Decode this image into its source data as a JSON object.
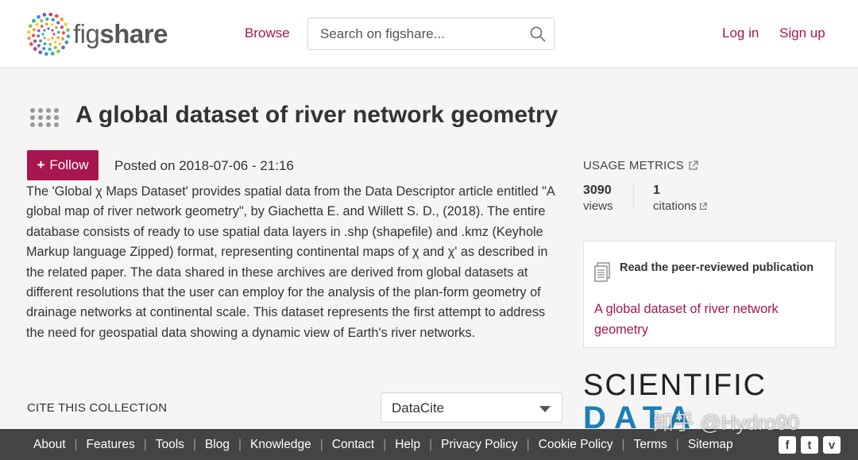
{
  "header": {
    "logo_text_fig": "fig",
    "logo_text_share": "share",
    "browse_label": "Browse",
    "search_placeholder": "Search on figshare...",
    "login_label": "Log in",
    "signup_label": "Sign up"
  },
  "item": {
    "title": "A global dataset of river network geometry",
    "follow_label": "Follow",
    "posted": "Posted on 2018-07-06 - 21:16",
    "description": "The 'Global χ Maps Dataset' provides spatial data from the Data Descriptor article entitled \"A global map of river network geometry\", by Giachetta E. and Willett S. D., (2018). The entire database consists of ready to use spatial data layers in .shp (shapefile) and .kmz (Keyhole Markup language Zipped) format, representing continental maps of χ and χ' as described in the related paper. The data shared in these archives are derived from global datasets at different resolutions that the user can employ for the analysis of the plan-form geometry of drainage networks at continental scale. This dataset represents the first attempt to address the need for geospatial data showing a dynamic view of Earth's river networks."
  },
  "cite": {
    "label": "CITE THIS COLLECTION",
    "selected": "DataCite"
  },
  "metrics": {
    "label": "USAGE METRICS",
    "views_count": "3090",
    "views_label": "views",
    "citations_count": "1",
    "citations_label": "citations"
  },
  "publication": {
    "heading": "Read the peer-reviewed publication",
    "link": "A global dataset of river network geometry"
  },
  "journal": {
    "line1": "SCIENTIFIC",
    "line2": "DATA"
  },
  "footer": {
    "links": [
      "About",
      "Features",
      "Tools",
      "Blog",
      "Knowledge",
      "Contact",
      "Help",
      "Privacy Policy",
      "Cookie Policy",
      "Terms",
      "Sitemap"
    ],
    "social": [
      "f",
      "t",
      "v"
    ]
  },
  "watermark": "知乎 @Hydro90",
  "colors": {
    "accent": "#a8164f",
    "footer_bg": "#444444",
    "page_bg": "#f5f5f5",
    "journal_blue": "#1b7fb8"
  }
}
